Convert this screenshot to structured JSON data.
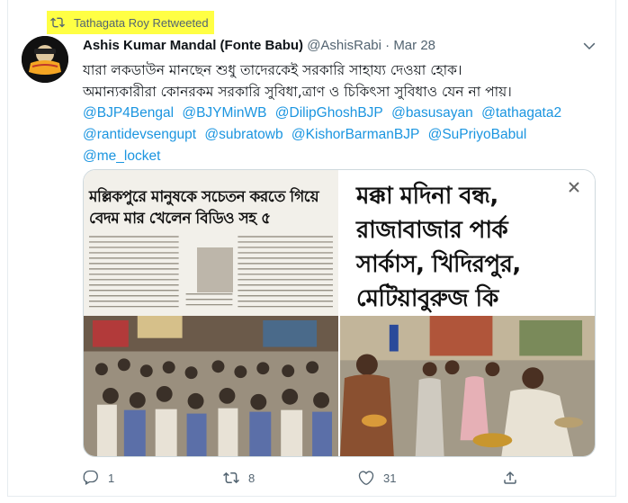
{
  "retweet_banner": {
    "text": "Tathagata Roy Retweeted"
  },
  "tweet": {
    "author_name": "Ashis Kumar Mandal (Fonte Babu)",
    "handle": "@AshisRabi",
    "separator": "·",
    "date": "Mar 28",
    "text_line1": "যারা লকডাউন মানছেন শুধু তাদেরকেই সরকারি সাহায্য দেওয়া হোক।",
    "text_line2": "অমান্যকারীরা কোনরকম সরকারি সুবিধা,ত্রাণ ও চিকিৎসা সুবিধাও যেন না পায়।",
    "mentions": [
      "@BJP4Bengal",
      "@BJYMinWB",
      "@DilipGhoshBJP",
      "@basusayan",
      "@tathagata2",
      "@rantidevsengupt",
      "@subratowb",
      "@KishorBarmanBJP",
      "@SuPriyoBabul",
      "@me_locket"
    ]
  },
  "media": {
    "left_headline": "মল্লিকপুরে মানুষকে সচেতন করতে গিয়ে বেদম মার খেলেন বিডিও সহ ৫",
    "right_headline": "মক্কা মদিনা বন্ধ, রাজাবাজার পার্ক সার্কাস, খিদিরপুর, মেটিয়াবুরুজ কি"
  },
  "actions": {
    "replies": "1",
    "retweets": "8",
    "likes": "31"
  },
  "colors": {
    "link": "#1b95e0",
    "muted": "#536471",
    "highlight": "#ffff44",
    "like": "#536471"
  },
  "icons": {
    "retweet": "retweet-icon",
    "reply": "reply-icon",
    "like": "heart-icon",
    "share": "share-icon",
    "more": "chevron-down-icon",
    "close": "close-icon"
  }
}
